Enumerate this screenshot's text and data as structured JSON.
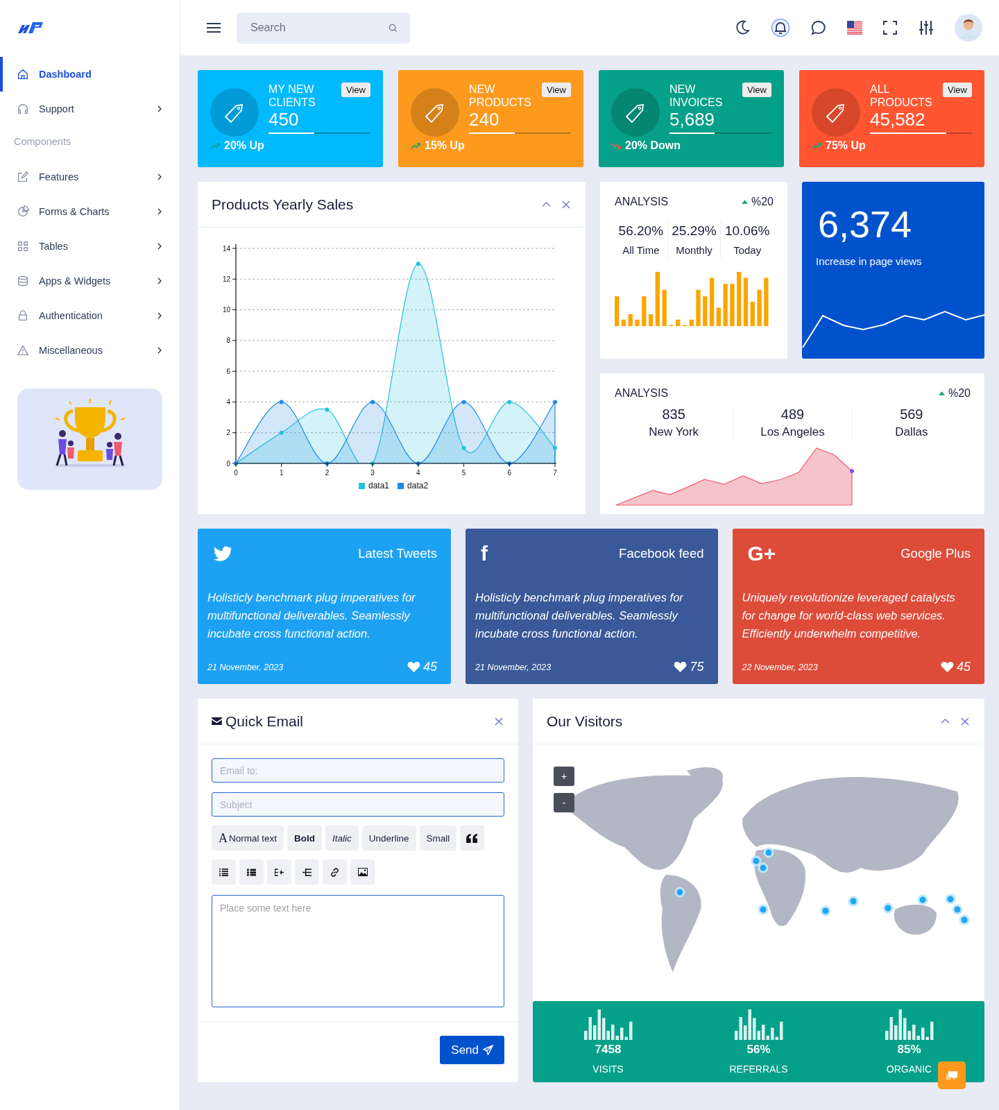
{
  "header": {
    "search": {
      "placeholder": "Search"
    }
  },
  "sidebar": {
    "items": [
      {
        "kind": "link",
        "label": "Dashboard",
        "selected": true,
        "has_submenu": false
      },
      {
        "kind": "link",
        "label": "Support",
        "selected": false,
        "has_submenu": true
      },
      {
        "kind": "section",
        "label": "Components"
      },
      {
        "kind": "link",
        "label": "Features",
        "selected": false,
        "has_submenu": true
      },
      {
        "kind": "link",
        "label": "Forms & Charts",
        "selected": false,
        "has_submenu": true
      },
      {
        "kind": "link",
        "label": "Tables",
        "selected": false,
        "has_submenu": true
      },
      {
        "kind": "link",
        "label": "Apps & Widgets",
        "selected": false,
        "has_submenu": true
      },
      {
        "kind": "link",
        "label": "Authentication",
        "selected": false,
        "has_submenu": true
      },
      {
        "kind": "link",
        "label": "Miscellaneous",
        "selected": false,
        "has_submenu": true
      }
    ]
  },
  "stat_cards": [
    {
      "title": "MY NEW CLIENTS",
      "value": "450",
      "button": "View",
      "level": 0.45,
      "kind": "up",
      "change": "20% Up",
      "color": "#00b9ff"
    },
    {
      "title": "NEW PRODUCTS",
      "value": "240",
      "button": "View",
      "level": 0.45,
      "kind": "up",
      "change": "15% Up",
      "color": "#fd9a1e"
    },
    {
      "title": "NEW INVOICES",
      "value": "5,689",
      "button": "View",
      "level": 0.44,
      "kind": "down",
      "change": "20% Down",
      "color": "#05a08a"
    },
    {
      "title": "ALL PRODUCTS",
      "value": "45,582",
      "button": "View",
      "level": 0.75,
      "kind": "up",
      "change": "75% Up",
      "color": "#ff5631"
    }
  ],
  "sales_card": {
    "title": "Products Yearly Sales",
    "chart_data": {
      "type": "area",
      "x": [
        0,
        1,
        2,
        3,
        4,
        5,
        6,
        7
      ],
      "xlim": [
        0,
        7
      ],
      "xticks": [
        0,
        1,
        2,
        3,
        4,
        5,
        6,
        7
      ],
      "ylim": [
        0,
        14
      ],
      "yticks": [
        0,
        2,
        4,
        6,
        8,
        10,
        12,
        14
      ],
      "grid": true,
      "legend": "bottom",
      "series": [
        {
          "name": "data1",
          "color": "#22c3da",
          "values": [
            0,
            2,
            3.5,
            0,
            13,
            1,
            4,
            1
          ]
        },
        {
          "name": "data2",
          "color": "#1e88e5",
          "values": [
            0,
            4,
            0,
            4,
            0,
            4,
            0,
            4
          ]
        }
      ]
    }
  },
  "analysis": {
    "title": "ANALYSIS",
    "change": "%20",
    "stats": [
      {
        "value": "56.20%",
        "label": "All Time"
      },
      {
        "value": "25.29%",
        "label": "Monthly"
      },
      {
        "value": "10.06%",
        "label": "Today"
      }
    ]
  },
  "page_views": {
    "value": "6,374",
    "label": "Increase in page views"
  },
  "city_analysis": {
    "title": "ANALYSIS",
    "change": "%20",
    "cities": [
      {
        "value": "835",
        "label": "New York"
      },
      {
        "value": "489",
        "label": "Los Angeles"
      },
      {
        "value": "569",
        "label": "Dallas"
      }
    ]
  },
  "social_cards": [
    {
      "kind": "bird",
      "title": "Latest Tweets",
      "text": "Holisticly benchmark plug imperatives for multifunctional deliverables. Seamlessly incubate cross functional action.",
      "date": "21 November, 2023",
      "likes": "45",
      "color": "#1da1f2"
    },
    {
      "kind": "letter",
      "logo": "f",
      "title": "Facebook feed",
      "text": "Holisticly benchmark plug imperatives for multifunctional deliverables. Seamlessly incubate cross functional action.",
      "date": "21 November, 2023",
      "likes": "75",
      "color": "#3b5998"
    },
    {
      "kind": "letter",
      "logo": "G+",
      "title": "Google Plus",
      "text": "Uniquely revolutionize leveraged catalysts for change for world-class web services. Efficiently underwhelm competitive.",
      "date": "22 November, 2023",
      "likes": "45",
      "color": "#dd4b39"
    }
  ],
  "quick_email": {
    "title": "Quick Email",
    "fields": [
      {
        "placeholder": "Email to:"
      },
      {
        "placeholder": "Subject"
      }
    ],
    "format_buttons": [
      {
        "glyph": "A",
        "label": "Normal text",
        "kind": "plain"
      },
      {
        "label": "Bold",
        "kind": "bold"
      },
      {
        "label": "Italic",
        "kind": "italic"
      },
      {
        "label": "Underline",
        "kind": "plain"
      },
      {
        "label": "Small",
        "kind": "plain"
      }
    ],
    "body": {
      "placeholder": "Place some text here"
    },
    "send": "Send"
  },
  "visitors": {
    "title": "Our Visitors",
    "zoom": [
      "+",
      "-"
    ],
    "stats": [
      {
        "value": "7458",
        "label": "VISITS"
      },
      {
        "value": "56%",
        "label": "REFERRALS"
      },
      {
        "value": "85%",
        "label": "ORGANIC"
      }
    ]
  }
}
